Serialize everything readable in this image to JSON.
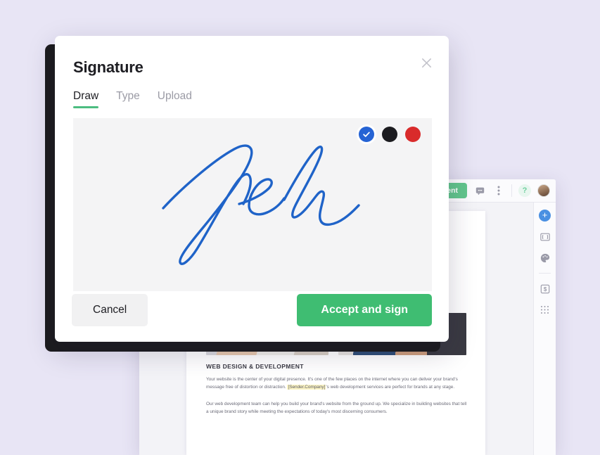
{
  "background": {
    "page_color": "#e8e5f5"
  },
  "app": {
    "toolbar": {
      "send_document_label": "Send document",
      "comment_icon": "comment-icon",
      "more_icon": "kebab-menu-icon",
      "help_label": "?",
      "avatar_icon": "user-avatar"
    },
    "canvas": {
      "block_handle": "•••"
    },
    "document": {
      "heading": "WEB DESIGN & DEVELOPMENT",
      "paragraph_1_before": "Your website is the center of your digital presence. It's one of the few places on the internet where you can deliver your brand's message free of distortion or distraction. ",
      "paragraph_1_token": "[Sender.Company]",
      "paragraph_1_after": "'s web development services are perfect for brands at any stage.",
      "paragraph_2": "Our web development team can help you build your brand's website from the ground up. We specialize in building websites that tell a unique brand story while meeting the expectations of today's most discerning consumers.",
      "image_1": "desk-laptop-photo",
      "image_2": "person-working-photo"
    },
    "rail": {
      "add_icon": "plus-circle-icon",
      "field_icon": "text-field-icon",
      "palette_icon": "palette-icon",
      "pricing_icon": "pricing-dollar-icon",
      "apps_icon": "apps-grid-icon"
    }
  },
  "modal": {
    "title": "Signature",
    "close_icon": "close-icon",
    "tabs": [
      {
        "label": "Draw",
        "active": true
      },
      {
        "label": "Type",
        "active": false
      },
      {
        "label": "Upload",
        "active": false
      }
    ],
    "pad": {
      "signature_alt": "handwritten-signature",
      "ink_color": "#1f63c8",
      "background_color": "#f4f4f5"
    },
    "colors": [
      {
        "name": "blue",
        "hex": "#2563d4",
        "selected": true
      },
      {
        "name": "black",
        "hex": "#1b1b1f",
        "selected": false
      },
      {
        "name": "red",
        "hex": "#d92b2b",
        "selected": false
      }
    ],
    "cancel_label": "Cancel",
    "accept_label": "Accept and sign"
  }
}
